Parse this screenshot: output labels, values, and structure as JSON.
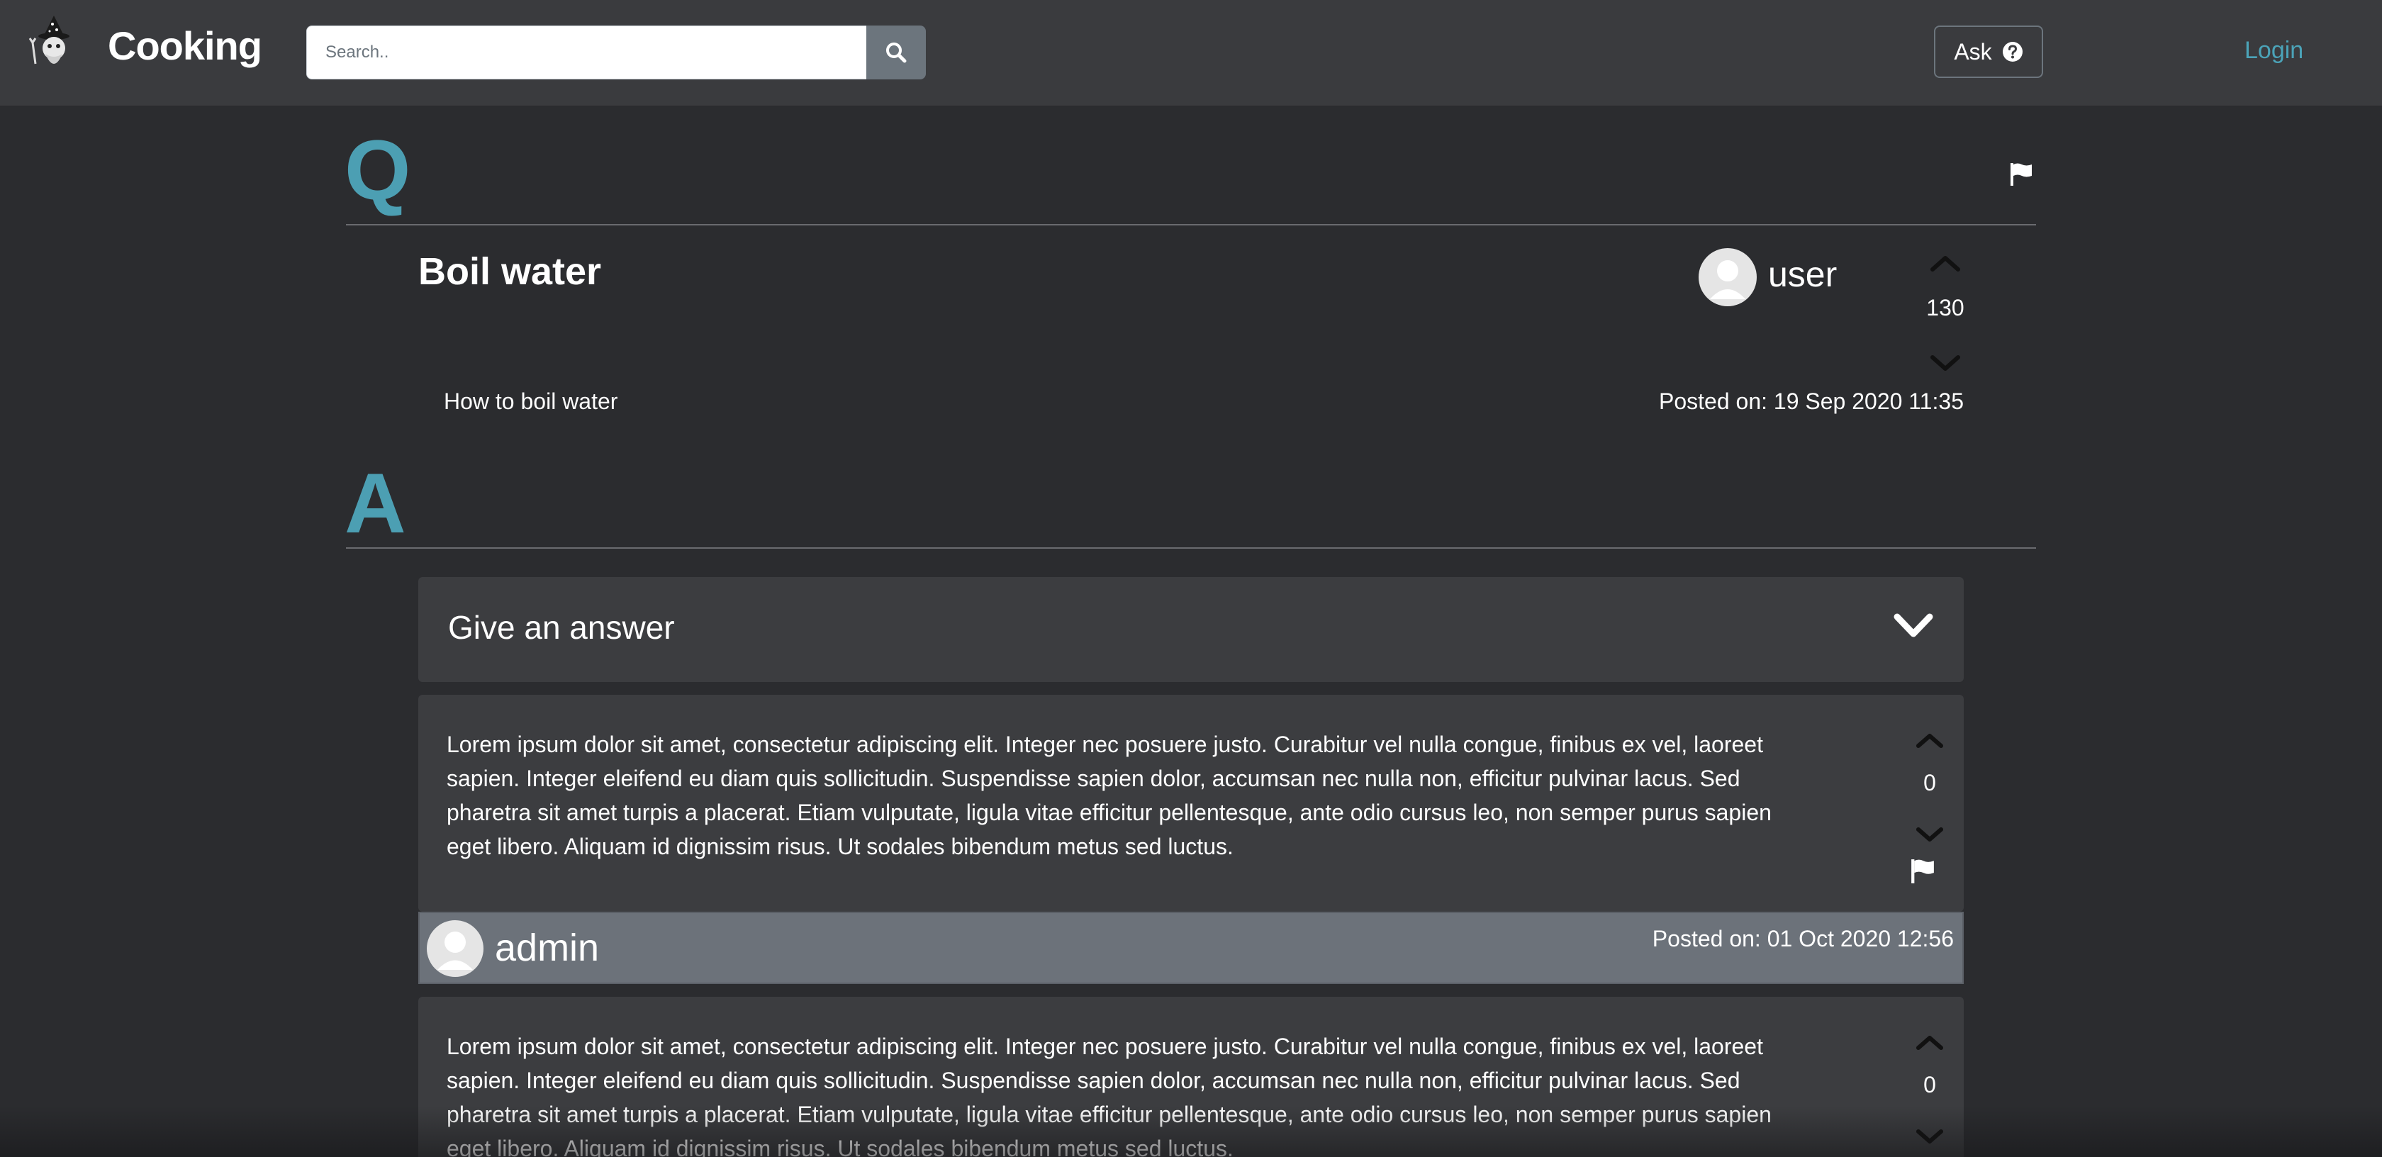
{
  "header": {
    "brand": "Cooking",
    "search": {
      "placeholder": "Search..",
      "value": ""
    },
    "ask_label": "Ask",
    "login_label": "Login"
  },
  "question": {
    "section_letter": "Q",
    "title": "Boil water",
    "username": "user",
    "votes": "130",
    "body": "How to boil water",
    "posted": "Posted on: 19 Sep 2020 11:35"
  },
  "answers_section": {
    "section_letter": "A",
    "give_answer_label": "Give an answer"
  },
  "answers": [
    {
      "text": "Lorem ipsum dolor sit amet, consectetur adipiscing elit. Integer nec posuere justo. Curabitur vel nulla congue, finibus ex vel, laoreet sapien. Integer eleifend eu diam quis sollicitudin. Suspendisse sapien dolor, accumsan nec nulla non, efficitur pulvinar lacus. Sed pharetra sit amet turpis a placerat. Etiam vulputate, ligula vitae efficitur pellentesque, ante odio cursus leo, non semper purus sapien eget libero. Aliquam id dignissim risus. Ut sodales bibendum metus sed luctus.",
      "votes": "0",
      "username": "admin",
      "posted": "Posted on: 01 Oct 2020 12:56"
    },
    {
      "text": "Lorem ipsum dolor sit amet, consectetur adipiscing elit. Integer nec posuere justo. Curabitur vel nulla congue, finibus ex vel, laoreet sapien. Integer eleifend eu diam quis sollicitudin. Suspendisse sapien dolor, accumsan nec nulla non, efficitur pulvinar lacus. Sed pharetra sit amet turpis a placerat. Etiam vulputate, ligula vitae efficitur pellentesque, ante odio cursus leo, non semper purus sapien eget libero. Aliquam id dignissim risus. Ut sodales bibendum metus sed luctus.",
      "votes": "0"
    }
  ],
  "colors": {
    "background": "#2b2c2f",
    "navbar": "#3a3b3e",
    "accent": "#4c9fb3",
    "card": "#3c3d40",
    "footer": "#6c727a"
  }
}
